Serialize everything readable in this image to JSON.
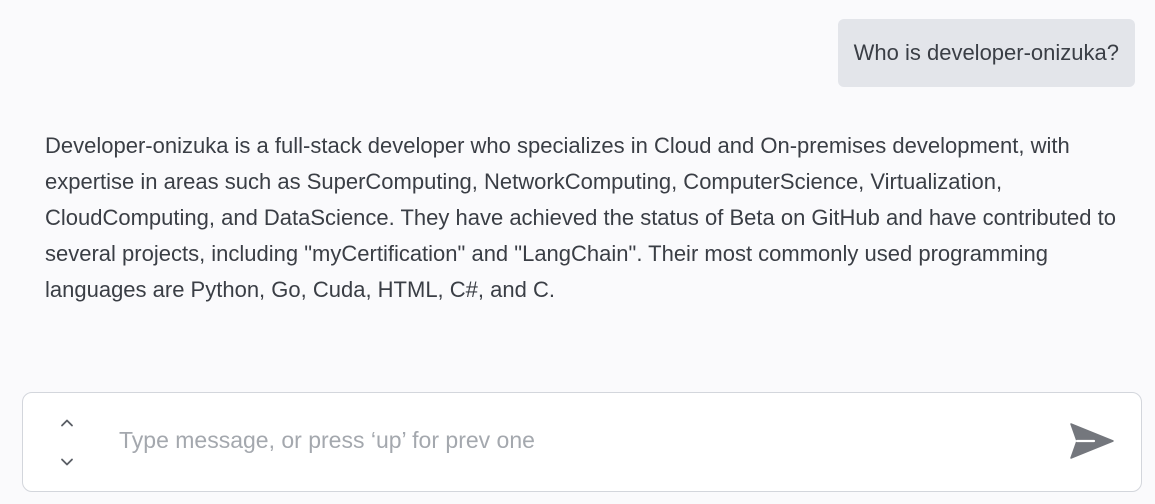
{
  "conversation": {
    "user_message": "Who is developer-onizuka?",
    "assistant_message": "Developer-onizuka is a full-stack developer who specializes in Cloud and On-premises development, with expertise in areas such as SuperComputing, NetworkComputing, ComputerScience, Virtualization, CloudComputing, and DataScience. They have achieved the status of Beta on GitHub and have contributed to several projects, including \"myCertification\" and \"LangChain\". Their most commonly used programming languages are Python, Go, Cuda, HTML, C#, and C."
  },
  "composer": {
    "placeholder": "Type message, or press ‘up’ for prev one",
    "value": "",
    "icons": {
      "history_up": "chevron-up-icon",
      "history_down": "chevron-down-icon",
      "send": "send-icon"
    }
  },
  "colors": {
    "background": "#fafafc",
    "user_bubble": "#e3e5ea",
    "text": "#3a3e45",
    "placeholder": "#a4a8ae",
    "icon": "#74777d"
  }
}
